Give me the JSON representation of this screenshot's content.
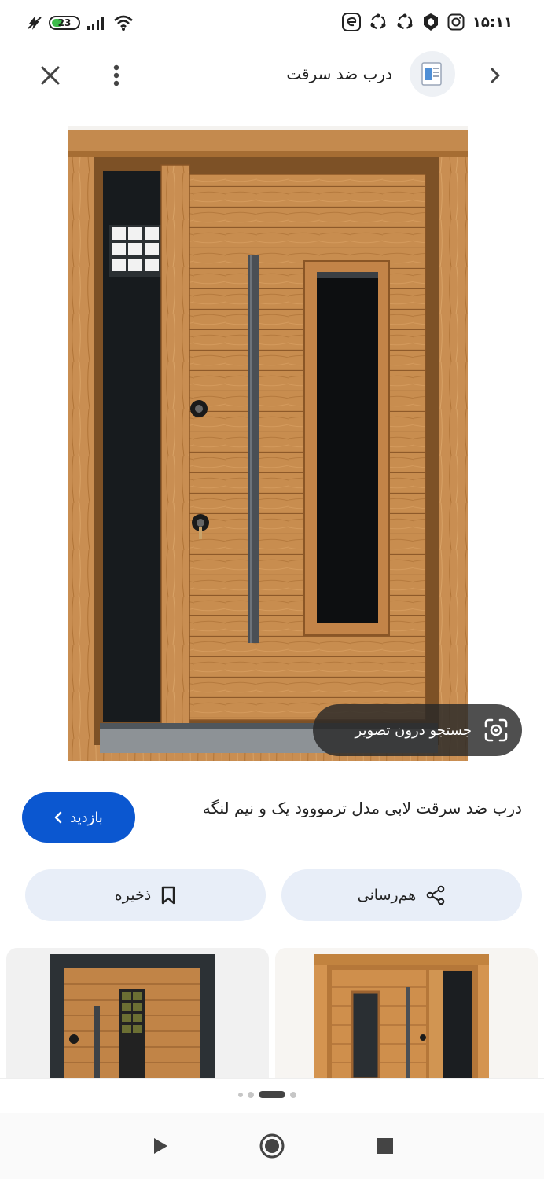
{
  "status_bar": {
    "battery_level": "23",
    "time": "۱۵:۱۱",
    "icons": [
      "charging-icon",
      "signal-icon",
      "wifi-icon",
      "edge-app-icon",
      "sync-icon",
      "sync-icon",
      "shield-icon",
      "instagram-icon"
    ]
  },
  "header": {
    "title": "درب ضد سرقت",
    "close_icon": "close-icon",
    "menu_icon": "more-vertical-icon",
    "forward_icon": "chevron-right-icon"
  },
  "lens": {
    "label": "جستجو درون تصویر",
    "icon": "lens-icon"
  },
  "result": {
    "caption": "درب ضد سرقت لابی مدل ترمووود یک و نیم لنگه",
    "visit_label": "بازدید",
    "visit_color": "#0b57d0"
  },
  "actions": {
    "share_label": "هم‌رسانی",
    "save_label": "ذخیره"
  },
  "carousel": {
    "active_index": 2,
    "count": 4
  },
  "nav": {
    "back": "back-triangle-icon",
    "home": "home-circle-icon",
    "recents": "recents-square-icon"
  }
}
